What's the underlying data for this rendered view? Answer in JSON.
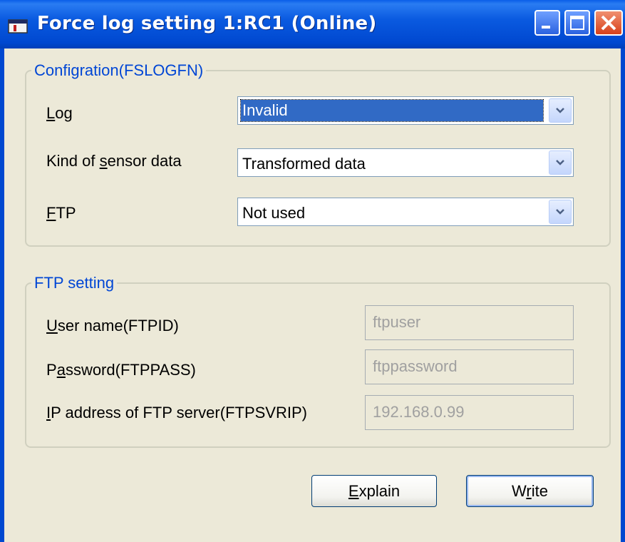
{
  "window": {
    "title": "Force log setting 1:RC1 (Online)",
    "icon": "app-icon"
  },
  "configuration": {
    "legend": "Configration(FSLOGFN)",
    "log": {
      "label": "Log",
      "value": "Invalid"
    },
    "kind_of_sensor_data": {
      "label": "Kind of sensor data",
      "value": "Transformed data"
    },
    "ftp": {
      "label": "FTP",
      "value": "Not used"
    }
  },
  "ftp_setting": {
    "legend": "FTP setting",
    "user_name": {
      "label": "User name(FTPID)",
      "value": "ftpuser"
    },
    "password": {
      "label": "Password(FTPPASS)",
      "value": "ftppassword"
    },
    "ip_address": {
      "label": "IP address of FTP server(FTPSVRIP)",
      "value": "192.168.0.99"
    }
  },
  "buttons": {
    "explain": "Explain",
    "write": "Write"
  },
  "colors": {
    "titlebar": "#0a5ae0",
    "dialog_bg": "#ece9d8",
    "group_legend": "#0046d5",
    "selection": "#316ac5"
  }
}
